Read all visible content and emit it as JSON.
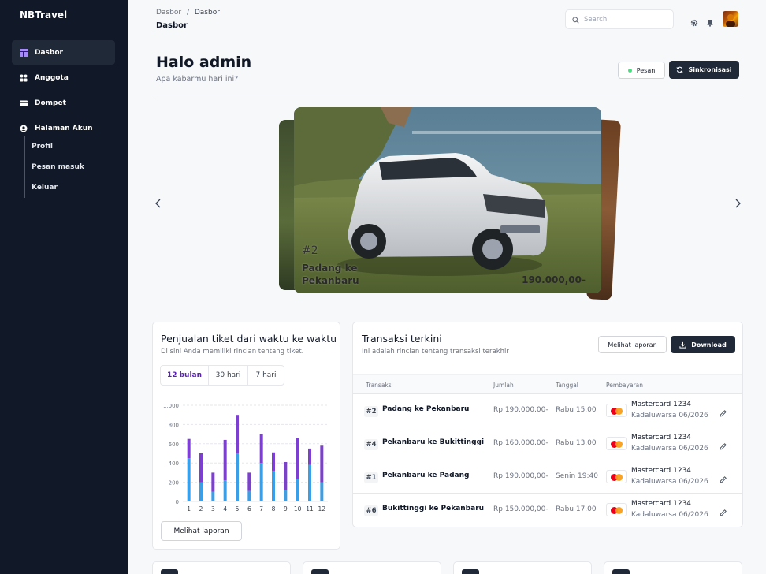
{
  "sidebar": {
    "brand": "NBTravel",
    "items": [
      {
        "label": "Dasbor",
        "icon": "dashboard-icon",
        "active": true
      },
      {
        "label": "Anggota",
        "icon": "members-icon"
      },
      {
        "label": "Dompet",
        "icon": "wallet-icon"
      },
      {
        "label": "Halaman Akun",
        "icon": "user-circle-icon"
      }
    ],
    "sub_items": [
      {
        "label": "Profil"
      },
      {
        "label": "Pesan masuk"
      },
      {
        "label": "Keluar"
      }
    ]
  },
  "header": {
    "breadcrumb": [
      "Dasbor",
      "Dasbor"
    ],
    "breadcrumb_sep": "/",
    "title": "Dasbor",
    "search_placeholder": "Search"
  },
  "greeting": {
    "title": "Halo admin",
    "subtitle": "Apa kabarmu hari ini?",
    "message_button": "Pesan",
    "sync_button": "Sinkronisasi"
  },
  "carousel": {
    "number": "#2",
    "route_line1": "Padang ke",
    "route_line2": "Pekanbaru",
    "price": "190.000,00-"
  },
  "sales": {
    "title": "Penjualan tiket dari waktu ke waktu",
    "subtitle": "Di sini Anda memiliki rincian tentang tiket.",
    "tabs": [
      "12 bulan",
      "30 hari",
      "7 hari"
    ],
    "active_tab": 0,
    "report_button": "Melihat laporan"
  },
  "chart_data": {
    "type": "bar",
    "stacked": true,
    "categories": [
      "1",
      "2",
      "3",
      "4",
      "5",
      "6",
      "7",
      "8",
      "9",
      "10",
      "11",
      "12"
    ],
    "series": [
      {
        "color": "#3b9fe8",
        "values": [
          450,
          200,
          100,
          220,
          500,
          110,
          400,
          320,
          120,
          230,
          380,
          200
        ]
      },
      {
        "color": "#7c3fd0",
        "values": [
          200,
          300,
          200,
          420,
          400,
          190,
          300,
          190,
          290,
          430,
          170,
          380
        ]
      }
    ],
    "ylim": [
      0,
      1000
    ],
    "yticks": [
      "0",
      "200",
      "400",
      "600",
      "800",
      "1,000"
    ],
    "grid": true
  },
  "transactions": {
    "title": "Transaksi terkini",
    "subtitle": "Ini adalah rincian tentang transaksi terakhir",
    "report_button": "Melihat laporan",
    "download_button": "Download",
    "columns": [
      "Transaksi",
      "Jumlah",
      "Tanggal",
      "Pembayaran"
    ],
    "rows": [
      {
        "id": "#2",
        "name": "Padang ke Pekanbaru",
        "amount": "Rp 190.000,00-",
        "date": "Rabu 15.00",
        "card": "Mastercard 1234",
        "expiry": "Kadaluwarsa 06/2026"
      },
      {
        "id": "#4",
        "name": "Pekanbaru ke Bukittinggi",
        "amount": "Rp 160.000,00-",
        "date": "Rabu 13.00",
        "card": "Mastercard 1234",
        "expiry": "Kadaluwarsa 06/2026"
      },
      {
        "id": "#1",
        "name": "Pekanbaru ke Padang",
        "amount": "Rp 190.000,00-",
        "date": "Senin 19:40",
        "card": "Mastercard 1234",
        "expiry": "Kadaluwarsa 06/2026"
      },
      {
        "id": "#6",
        "name": "Bukittinggi ke Pekanbaru",
        "amount": "Rp 150.000,00-",
        "date": "Rabu 17.00",
        "card": "Mastercard 1234",
        "expiry": "Kadaluwarsa 06/2026"
      }
    ]
  }
}
